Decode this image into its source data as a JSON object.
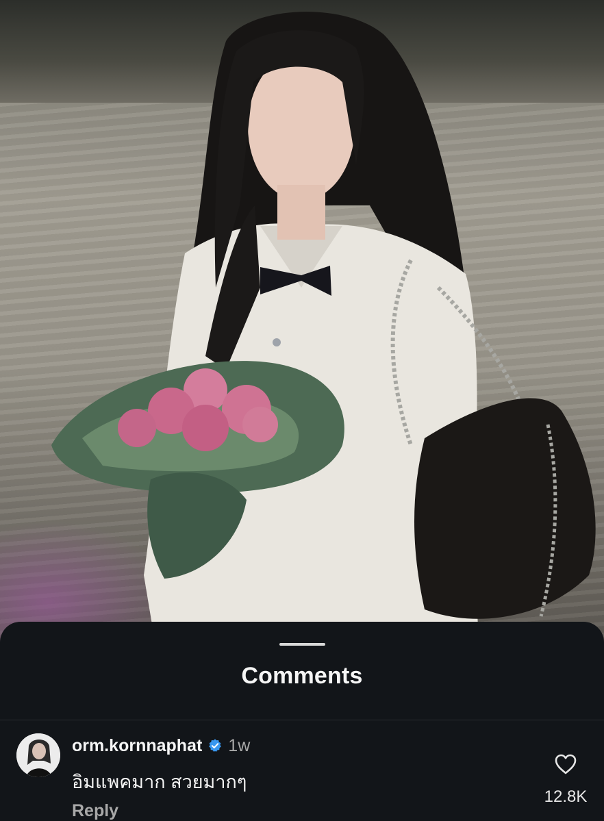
{
  "sheet": {
    "title": "Comments"
  },
  "comments": [
    {
      "username": "orm.kornnaphat",
      "verified": true,
      "time": "1w",
      "text": "อิมแพคมาก สวยมากๆ",
      "reply_label": "Reply",
      "likes": "12.8K"
    }
  ],
  "icons": {
    "handle": "grab-handle",
    "verified": "verified-badge-icon",
    "like": "heart-outline-icon"
  },
  "colors": {
    "sheet_bg": "#121519",
    "text_primary": "#f5f5f5",
    "text_secondary": "#a8a8a8",
    "verified_blue": "#3897f0"
  }
}
